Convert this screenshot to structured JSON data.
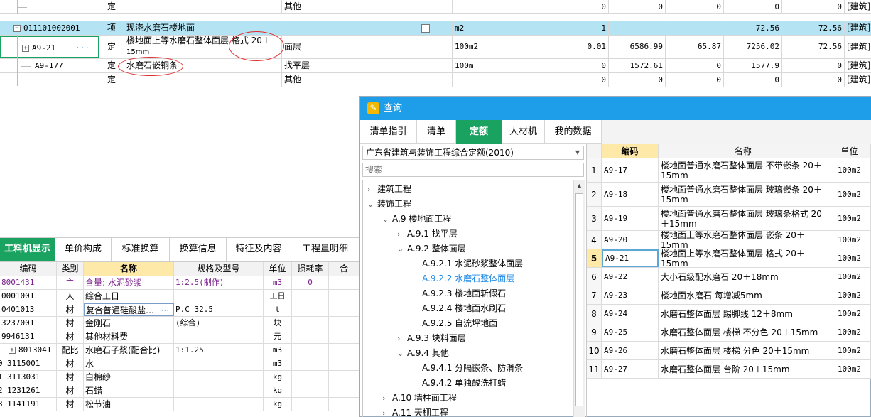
{
  "top_grid": {
    "rows": [
      {
        "code": "",
        "type": "定",
        "name": "",
        "spec": "其他",
        "unit": "",
        "qty": "0",
        "p1": "0",
        "p2": "0",
        "p3": "0",
        "p4": "0",
        "prof": "[建筑]"
      },
      {
        "code": "011101002001",
        "type": "项",
        "name": "现浇水磨石楼地面",
        "spec": "",
        "unit": "m2",
        "qty": "1",
        "p1": "",
        "p2": "",
        "p3": "72.56",
        "p4": "72.56",
        "prof": "[建筑]"
      },
      {
        "code": "A9-21",
        "type": "定",
        "name": "楼地面上等水磨石整体面层 格式 20＋",
        "name2": "15mm",
        "spec": "面层",
        "unit": "100m2",
        "qty": "0.01",
        "p1": "6586.99",
        "p2": "65.87",
        "p3": "7256.02",
        "p4": "72.56",
        "prof": "[建筑]"
      },
      {
        "code": "A9-177",
        "type": "定",
        "name": "水磨石嵌铜条",
        "spec": "找平层",
        "unit": "100m",
        "qty": "0",
        "p1": "1572.61",
        "p2": "0",
        "p3": "1577.9",
        "p4": "0",
        "prof": "[建筑]"
      },
      {
        "code": "",
        "type": "定",
        "name": "",
        "spec": "其他",
        "unit": "",
        "qty": "0",
        "p1": "0",
        "p2": "0",
        "p3": "0",
        "p4": "0",
        "prof": "[建筑]"
      }
    ],
    "expand_minus": "−",
    "expand_plus": "+",
    "more": "···"
  },
  "bottom_panel": {
    "tabs": [
      "工料机显示",
      "单价构成",
      "标准换算",
      "换算信息",
      "特征及内容",
      "工程量明细"
    ],
    "headers": [
      "编码",
      "类别",
      "名称",
      "规格及型号",
      "单位",
      "损耗率",
      "合"
    ],
    "rows": [
      {
        "idx": "",
        "code": "8001431",
        "type": "主",
        "name": "含量: 水泥砂浆",
        "spec": "1:2.5(制作)",
        "unit": "m3",
        "loss": "0"
      },
      {
        "idx": "",
        "code": "0001001",
        "type": "人",
        "name": "综合工日",
        "spec": "",
        "unit": "工日",
        "loss": ""
      },
      {
        "idx": "",
        "code": "0401013",
        "type": "材",
        "name": "复合普通硅酸盐…",
        "spec": "P.C 32.5",
        "unit": "t",
        "loss": ""
      },
      {
        "idx": "",
        "code": "3237001",
        "type": "材",
        "name": "金刚石",
        "spec": "(综合)",
        "unit": "块",
        "loss": ""
      },
      {
        "idx": "",
        "code": "9946131",
        "type": "材",
        "name": "其他材料费",
        "spec": "",
        "unit": "元",
        "loss": ""
      },
      {
        "idx": "",
        "code": "8013041",
        "type": "配比",
        "name": "水磨石子浆(配合比)",
        "spec": "1:1.25",
        "unit": "m3",
        "loss": ""
      },
      {
        "idx": "0",
        "code": "3115001",
        "type": "材",
        "name": "水",
        "spec": "",
        "unit": "m3",
        "loss": ""
      },
      {
        "idx": "1",
        "code": "3113031",
        "type": "材",
        "name": "白棉纱",
        "spec": "",
        "unit": "kg",
        "loss": ""
      },
      {
        "idx": "2",
        "code": "1231261",
        "type": "材",
        "name": "石蜡",
        "spec": "",
        "unit": "kg",
        "loss": ""
      },
      {
        "idx": "3",
        "code": "1141191",
        "type": "材",
        "name": "松节油",
        "spec": "",
        "unit": "kg",
        "loss": ""
      }
    ]
  },
  "dialog": {
    "title": "查询",
    "tabs": [
      "清单指引",
      "清单",
      "定额",
      "人材机",
      "我的数据"
    ],
    "active_tab": "定额",
    "library": "广东省建筑与装饰工程综合定额(2010)",
    "search_placeholder": "搜索",
    "tree": [
      {
        "label": "建筑工程",
        "level": 0,
        "state": "collapsed"
      },
      {
        "label": "装饰工程",
        "level": 0,
        "state": "expanded"
      },
      {
        "label": "A.9 楼地面工程",
        "level": 1,
        "state": "expanded"
      },
      {
        "label": "A.9.1 找平层",
        "level": 2,
        "state": "collapsed"
      },
      {
        "label": "A.9.2 整体面层",
        "level": 2,
        "state": "expanded"
      },
      {
        "label": "A.9.2.1 水泥砂浆整体面层",
        "level": 3,
        "state": "leaf"
      },
      {
        "label": "A.9.2.2 水磨石整体面层",
        "level": 3,
        "state": "leaf",
        "selected": true
      },
      {
        "label": "A.9.2.3 楼地面斩假石",
        "level": 3,
        "state": "leaf"
      },
      {
        "label": "A.9.2.4 楼地面水刷石",
        "level": 3,
        "state": "leaf"
      },
      {
        "label": "A.9.2.5 自流坪地面",
        "level": 3,
        "state": "leaf"
      },
      {
        "label": "A.9.3 块料面层",
        "level": 2,
        "state": "collapsed"
      },
      {
        "label": "A.9.4 其他",
        "level": 2,
        "state": "expanded"
      },
      {
        "label": "A.9.4.1 分隔嵌条、防滑条",
        "level": 3,
        "state": "leaf"
      },
      {
        "label": "A.9.4.2 单独酸洗打蜡",
        "level": 3,
        "state": "leaf"
      },
      {
        "label": "A.10 墙柱面工程",
        "level": 1,
        "state": "collapsed"
      },
      {
        "label": "A.11 天棚工程",
        "level": 1,
        "state": "collapsed"
      }
    ],
    "result_headers": [
      "编码",
      "名称",
      "单位"
    ],
    "results": [
      {
        "n": "1",
        "code": "A9-17",
        "name": "楼地面普通水磨石整体面层 不带嵌条 20＋15mm",
        "unit": "100m2"
      },
      {
        "n": "2",
        "code": "A9-18",
        "name": "楼地面普通水磨石整体面层 玻璃嵌条 20＋15mm",
        "unit": "100m2"
      },
      {
        "n": "3",
        "code": "A9-19",
        "name": "楼地面普通水磨石整体面层 玻璃条格式 20＋15mm",
        "unit": "100m2"
      },
      {
        "n": "4",
        "code": "A9-20",
        "name": "楼地面上等水磨石整体面层 嵌条 20＋15mm",
        "unit": "100m2"
      },
      {
        "n": "5",
        "code": "A9-21",
        "name": "楼地面上等水磨石整体面层 格式 20＋15mm",
        "unit": "100m2"
      },
      {
        "n": "6",
        "code": "A9-22",
        "name": "大小石级配水磨石 20＋18mm",
        "unit": "100m2"
      },
      {
        "n": "7",
        "code": "A9-23",
        "name": "楼地面水磨石 每增减5mm",
        "unit": "100m2"
      },
      {
        "n": "8",
        "code": "A9-24",
        "name": "水磨石整体面层 踢脚线 12＋8mm",
        "unit": "100m2"
      },
      {
        "n": "9",
        "code": "A9-25",
        "name": "水磨石整体面层 楼梯 不分色 20＋15mm",
        "unit": "100m2"
      },
      {
        "n": "10",
        "code": "A9-26",
        "name": "水磨石整体面层 楼梯 分色 20＋15mm",
        "unit": "100m2"
      },
      {
        "n": "11",
        "code": "A9-27",
        "name": "水磨石整体面层 台阶 20＋15mm",
        "unit": "100m2"
      }
    ],
    "colors": {
      "tab_active": "#1aa260",
      "title_bar": "#1e9ee8",
      "tree_selected": "#1e88e5",
      "code_header": "#ffe9a8"
    }
  }
}
